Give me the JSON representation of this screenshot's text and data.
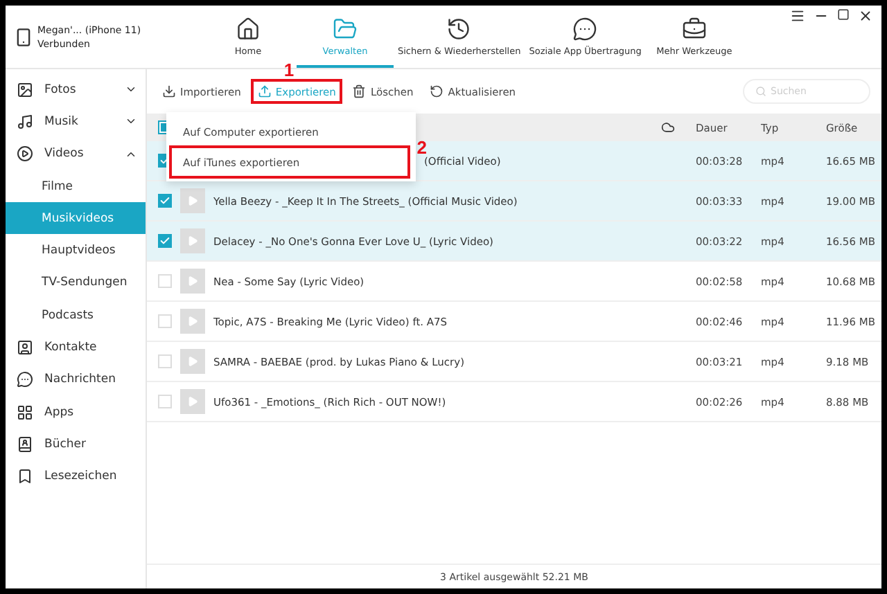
{
  "device": {
    "name": "Megan'... (iPhone 11)",
    "status": "Verbunden"
  },
  "nav": [
    {
      "kind": "home",
      "label": "Home",
      "selected": false
    },
    {
      "kind": "folder",
      "label": "Verwalten",
      "selected": true
    },
    {
      "kind": "restore",
      "label": "Sichern & Wiederherstellen",
      "selected": false
    },
    {
      "kind": "chat",
      "label": "Soziale App Übertragung",
      "selected": false
    },
    {
      "kind": "tools",
      "label": "Mehr Werkzeuge",
      "selected": false
    }
  ],
  "sidebar": [
    {
      "kind": "photo",
      "label": "Fotos",
      "expanded": false,
      "selected": false
    },
    {
      "kind": "music",
      "label": "Musik",
      "expanded": false,
      "selected": false
    },
    {
      "kind": "video",
      "label": "Videos",
      "expanded": true,
      "selected": false,
      "children": [
        {
          "label": "Filme",
          "selected": false
        },
        {
          "label": "Musikvideos",
          "selected": true
        },
        {
          "label": "Hauptvideos",
          "selected": false
        },
        {
          "label": "TV-Sendungen",
          "selected": false
        },
        {
          "label": "Podcasts",
          "selected": false
        }
      ]
    },
    {
      "kind": "contact",
      "label": "Kontakte",
      "selected": false
    },
    {
      "kind": "message",
      "label": "Nachrichten",
      "selected": false
    },
    {
      "kind": "apps",
      "label": "Apps",
      "selected": false
    },
    {
      "kind": "book",
      "label": "Bücher",
      "selected": false
    },
    {
      "kind": "bookmark",
      "label": "Lesezeichen",
      "selected": false
    }
  ],
  "toolbar": [
    {
      "kind": "import",
      "label": "Importieren",
      "selected": false,
      "highlighted": false
    },
    {
      "kind": "export",
      "label": "Exportieren",
      "selected": true,
      "highlighted": true,
      "callout": "1"
    },
    {
      "kind": "delete",
      "label": "Löschen",
      "selected": false,
      "highlighted": false
    },
    {
      "kind": "refresh",
      "label": "Aktualisieren",
      "selected": false,
      "highlighted": false
    }
  ],
  "search": {
    "placeholder": "Suchen"
  },
  "export_menu": [
    {
      "label": "Auf Computer exportieren",
      "highlighted": false
    },
    {
      "label": "Auf iTunes exportieren",
      "highlighted": true,
      "callout": "2"
    }
  ],
  "table": {
    "select_all": {
      "indeterminate": true
    },
    "columns": [
      "Dauer",
      "Typ",
      "Größe"
    ],
    "rows": [
      {
        "title": "(Official Video)",
        "covered": true,
        "checked": true,
        "duration": "00:03:28",
        "type": "mp4",
        "size": "16.65 MB"
      },
      {
        "title": "Yella Beezy - _Keep It In The Streets_ (Official Music Video)",
        "covered": false,
        "checked": true,
        "duration": "00:03:33",
        "type": "mp4",
        "size": "19.00 MB"
      },
      {
        "title": "Delacey - _No One's Gonna Ever Love U_ (Lyric Video)",
        "covered": false,
        "checked": true,
        "duration": "00:03:22",
        "type": "mp4",
        "size": "16.56 MB"
      },
      {
        "title": "Nea - Some Say (Lyric Video)",
        "covered": false,
        "checked": false,
        "duration": "00:02:58",
        "type": "mp4",
        "size": "10.68 MB"
      },
      {
        "title": "Topic, A7S - Breaking Me (Lyric Video) ft. A7S",
        "covered": false,
        "checked": false,
        "duration": "00:02:46",
        "type": "mp4",
        "size": "11.96 MB"
      },
      {
        "title": "SAMRA - BAEBAE (prod. by Lukas Piano & Lucry)",
        "covered": false,
        "checked": false,
        "duration": "00:03:21",
        "type": "mp4",
        "size": "9.18 MB"
      },
      {
        "title": "Ufo361 - _Emotions_ (Rich Rich - OUT NOW!)",
        "covered": false,
        "checked": false,
        "duration": "00:02:26",
        "type": "mp4",
        "size": "8.88 MB"
      }
    ]
  },
  "status_bar": "3 Artikel ausgewählt 52.21 MB"
}
